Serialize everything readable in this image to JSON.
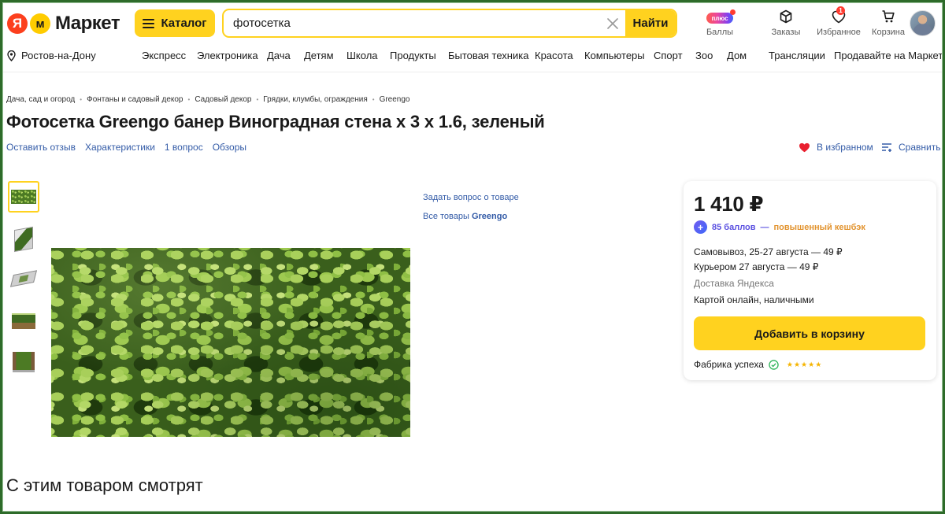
{
  "header": {
    "logo_ya": "Я",
    "logo_m": "м",
    "logo_text": "Маркет",
    "catalog_label": "Каталог",
    "search_value": "фотосетка",
    "search_button": "Найти",
    "actions": [
      {
        "label": "Баллы",
        "icon": "plus-points-icon"
      },
      {
        "label": "Заказы",
        "icon": "box-icon"
      },
      {
        "label": "Избранное",
        "icon": "heart-icon",
        "badge": "1"
      },
      {
        "label": "Корзина",
        "icon": "cart-icon"
      }
    ],
    "plus_label": "плюс",
    "location": "Ростов-на-Дону",
    "nav": [
      "Экспресс",
      "Электроника",
      "Дача",
      "Детям",
      "Школа",
      "Продукты",
      "Бытовая техника",
      "Красота",
      "Компьютеры",
      "Спорт",
      "Зоо",
      "Дом",
      "Трансляции",
      "Продавайте на Маркете"
    ]
  },
  "breadcrumb": [
    "Дача, сад и огород",
    "Фонтаны и садовый декор",
    "Садовый декор",
    "Грядки, клумбы, ограждения",
    "Greengo"
  ],
  "product": {
    "title": "Фотосетка Greengo банер Виноградная стена х 3 х 1.6, зеленый",
    "subnav": [
      "Оставить отзыв",
      "Характеристики",
      "1 вопрос",
      "Обзоры"
    ],
    "favorite_label": "В избранном",
    "compare_label": "Сравнить",
    "ask_question": "Задать вопрос о товаре",
    "all_products_prefix": "Все товары",
    "brand": "Greengo"
  },
  "buybox": {
    "price": "1 410 ₽",
    "cashback_points": "85 баллов",
    "cashback_dash": " — ",
    "cashback_text": "повышенный кешбэк",
    "pickup": "Самовывоз, 25-27 августа — 49 ₽",
    "courier": "Курьером 27 августа — 49 ₽",
    "delivery_service": "Доставка Яндекса",
    "payment": "Картой онлайн, наличными",
    "cart_button": "Добавить в корзину",
    "seller": "Фабрика успеха",
    "rating": 5
  },
  "related_title": "С этим товаром смотрят",
  "colors": {
    "accent": "#ffd21f",
    "link": "#335ba7",
    "brand_red": "#fc3f1d",
    "cashback_purple": "#5a50e0",
    "cashback_orange": "#e2932e",
    "frame": "#2e6b2a"
  }
}
